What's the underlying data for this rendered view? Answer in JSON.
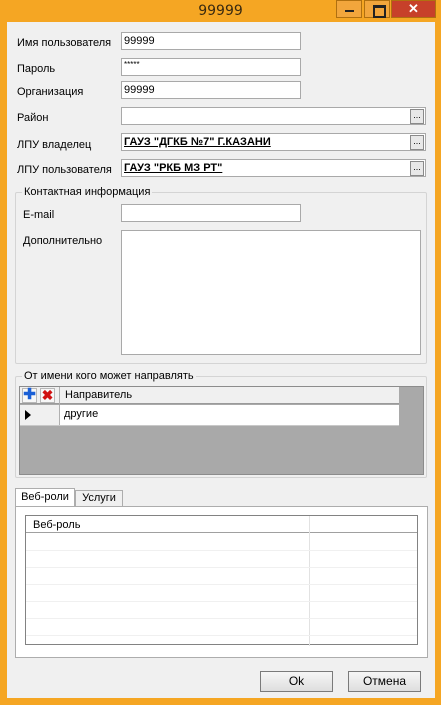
{
  "window": {
    "title": "99999"
  },
  "fields": {
    "username": {
      "label": "Имя пользователя",
      "value": "99999"
    },
    "password": {
      "label": "Пароль",
      "value": "*****"
    },
    "organization": {
      "label": "Организация",
      "value": "99999"
    },
    "district": {
      "label": "Район",
      "value": ""
    },
    "lpu_owner": {
      "label": "ЛПУ владелец",
      "value": "ГАУЗ \"ДГКБ №7\" Г.КАЗАНИ"
    },
    "lpu_user": {
      "label": "ЛПУ пользователя",
      "value": "ГАУЗ \"РКБ МЗ РТ\""
    }
  },
  "ellipsis_label": "...",
  "contact": {
    "title": "Контактная информация",
    "email_label": "E-mail",
    "email_value": "",
    "extra_label": "Дополнительно",
    "extra_value": ""
  },
  "senders": {
    "title": "От имени кого может направлять",
    "column_header": "Направитель",
    "rows": [
      {
        "name": "другие"
      }
    ]
  },
  "tabs": [
    {
      "label": "Веб-роли",
      "active": true
    },
    {
      "label": "Услуги",
      "active": false
    }
  ],
  "webroles": {
    "column_header": "Веб-роль"
  },
  "buttons": {
    "ok": "Ok",
    "cancel": "Отмена"
  },
  "colors": {
    "titlebar": "#f5a623",
    "close": "#c7402a",
    "grid_bg": "#a9a9a9"
  }
}
